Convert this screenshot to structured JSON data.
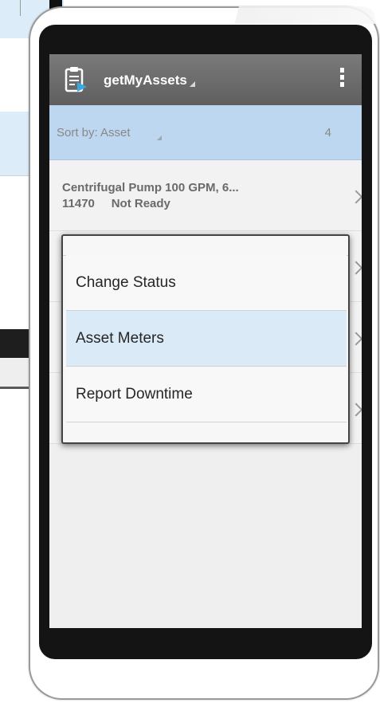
{
  "header": {
    "title": "getMyAssets",
    "icon": "clipboard-icon",
    "menu_icon": "overflow-menu-icon"
  },
  "sort_bar": {
    "label": "Sort by: Asset",
    "count": "4"
  },
  "list": [
    {
      "title": "Centrifugal Pump 100 GPM, 6...",
      "subtitle": "11470     Not Ready"
    }
  ],
  "popup_menu": {
    "items": [
      {
        "label": "Change Status",
        "selected": false
      },
      {
        "label": "Asset Meters",
        "selected": true
      },
      {
        "label": "Report Downtime",
        "selected": false
      }
    ]
  },
  "colors": {
    "header_bg": "#6a6a6a",
    "sort_bar_bg": "#bcd7ef",
    "selected_item_bg": "#daeaf7",
    "screen_bezel": "#141414"
  }
}
